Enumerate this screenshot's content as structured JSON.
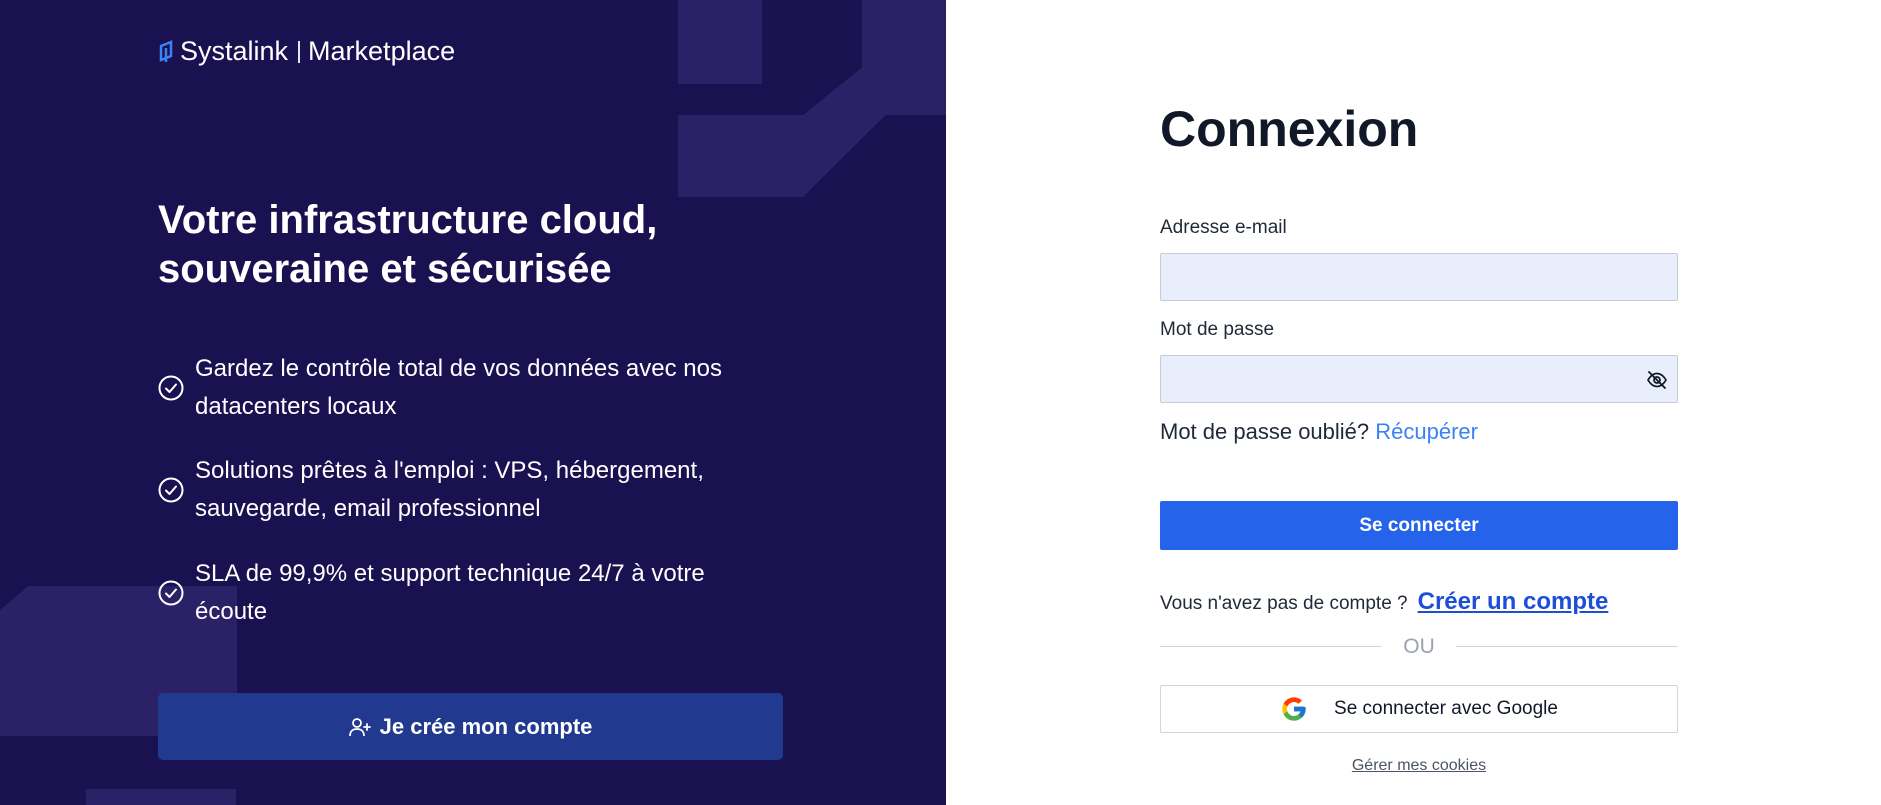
{
  "brand": {
    "name": "Systalink",
    "product": "Marketplace"
  },
  "hero": {
    "title": "Votre infrastructure cloud, souveraine et sécurisée"
  },
  "features": [
    {
      "text": "Gardez le contrôle total de vos données avec nos datacenters locaux",
      "icon": "check-circle-icon"
    },
    {
      "text": "Solutions prêtes à l'emploi : VPS, hébergement, sauvegarde, email professionnel",
      "icon": "check-circle-icon"
    },
    {
      "text": "SLA de 99,9% et support technique 24/7 à votre écoute",
      "icon": "check-circle-icon"
    }
  ],
  "cta": {
    "label": "Je crée mon compte",
    "icon": "user-plus-icon"
  },
  "login": {
    "title": "Connexion",
    "email_label": "Adresse e-mail",
    "email_value": "",
    "password_label": "Mot de passe",
    "password_value": "",
    "forgot_text": "Mot de passe oublié?",
    "forgot_link": "Récupérer",
    "submit_label": "Se connecter",
    "no_account_text": "Vous n'avez pas de compte ?",
    "create_account_link": "Créer un compte",
    "or_text": "OU",
    "google_label": "Se connecter avec Google",
    "cookies_link": "Gérer mes cookies"
  },
  "colors": {
    "left_bg": "#1a1150",
    "accent": "#2563eb",
    "cta_bg": "#213a8f",
    "input_bg": "#e8eefc",
    "link": "#3b82f6"
  }
}
